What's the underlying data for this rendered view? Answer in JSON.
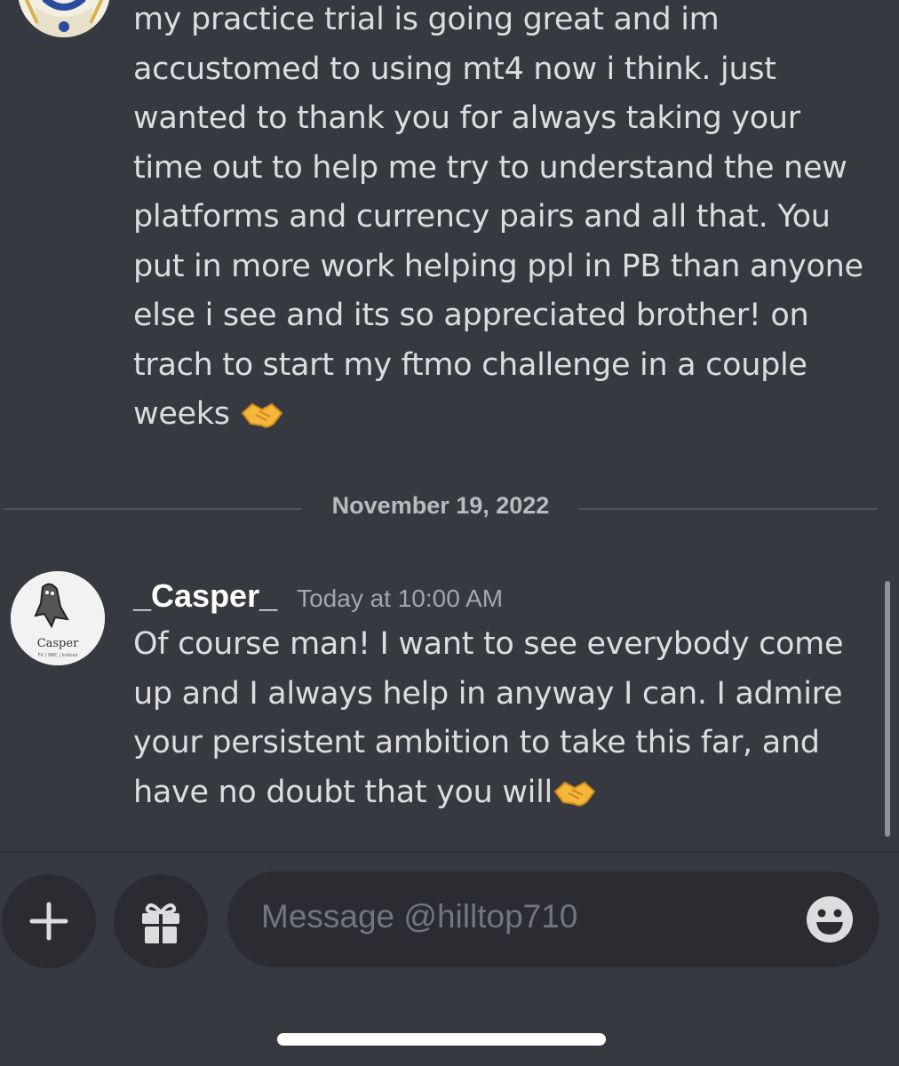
{
  "messages": [
    {
      "text": "my practice trial is going great and im\naccustomed to using mt4 now i think. just\nwanted to thank you for always taking your\ntime out to help me try to understand the new\nplatforms and currency pairs and all that. You\nput in more work helping ppl in PB than anyone\nelse i see and its so appreciated brother! on\ntrach to start my ftmo challenge in a couple\nweeks ",
      "emoji": "handshake-icon"
    },
    {
      "author": "_Casper_",
      "timestamp": "Today at 10:00 AM",
      "text": "Of course man! I want to see everybody come\nup and I always help in anyway I can. I admire\nyour persistent ambition to take this far, and\nhave no doubt that you will",
      "emoji": "handshake-icon"
    }
  ],
  "date_divider": "November 19, 2022",
  "avatar": {
    "brand_text": "Casper",
    "sub_text": "FX | SMC | Indices"
  },
  "composer": {
    "placeholder": "Message @hilltop710"
  },
  "colors": {
    "background": "#36393f",
    "text": "#dcddde",
    "username": "#ffffff",
    "timestamp": "#a3a6aa",
    "input_bg": "#2a2c31"
  }
}
